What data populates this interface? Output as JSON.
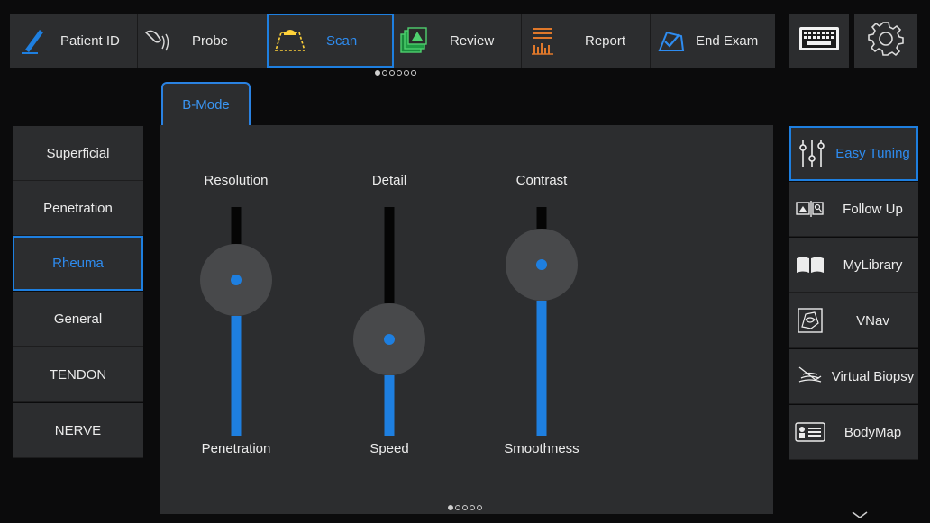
{
  "toolbar": {
    "items": [
      {
        "label": "Patient ID",
        "icon": "pen-icon"
      },
      {
        "label": "Probe",
        "icon": "probe-icon"
      },
      {
        "label": "Scan",
        "icon": "scan-icon",
        "active": true
      },
      {
        "label": "Review",
        "icon": "review-icon"
      },
      {
        "label": "Report",
        "icon": "report-icon"
      },
      {
        "label": "End Exam",
        "icon": "end-exam-icon"
      }
    ],
    "keyboard_icon": "keyboard-icon",
    "settings_icon": "gear-icon"
  },
  "mode_tab": "B-Mode",
  "presets": [
    "Superficial",
    "Penetration",
    "Rheuma",
    "General",
    "TENDON",
    "NERVE"
  ],
  "active_preset": "Rheuma",
  "sliders": [
    {
      "top_label": "Resolution",
      "bottom_label": "Penetration",
      "level": 0.68
    },
    {
      "top_label": "Detail",
      "bottom_label": "Speed",
      "level": 0.42
    },
    {
      "top_label": "Contrast",
      "bottom_label": "Smoothness",
      "level": 0.75
    }
  ],
  "right_tools": [
    {
      "label": "Easy Tuning",
      "icon": "tuning-sliders-icon",
      "active": true
    },
    {
      "label": "Follow Up",
      "icon": "follow-up-icon"
    },
    {
      "label": "MyLibrary",
      "icon": "book-icon"
    },
    {
      "label": "VNav",
      "icon": "vnav-icon"
    },
    {
      "label": "Virtual Biopsy",
      "icon": "biopsy-icon"
    },
    {
      "label": "BodyMap",
      "icon": "bodymap-icon"
    }
  ],
  "colors": {
    "accent": "#1e7fe0",
    "panel": "#2c2d2f",
    "background": "#0b0b0c"
  }
}
